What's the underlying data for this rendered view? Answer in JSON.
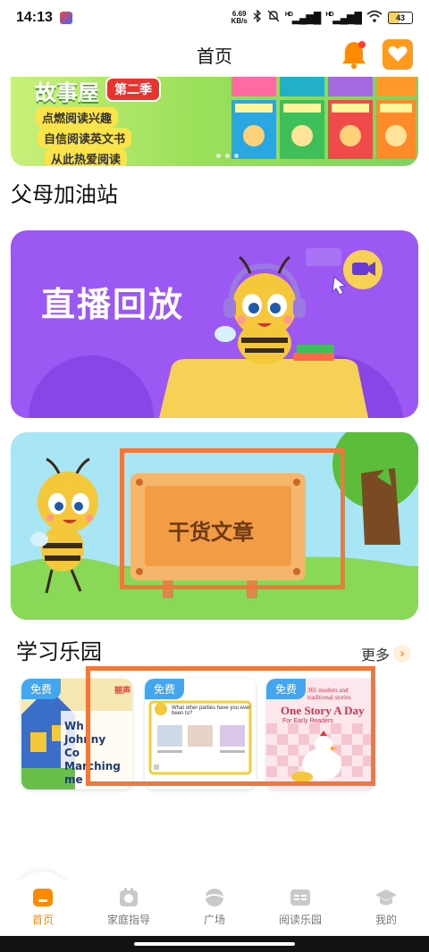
{
  "status_bar": {
    "time": "14:13",
    "net_speed_value": "6.69",
    "net_speed_unit": "KB/s",
    "signal_1": "HD",
    "signal_2": "HD",
    "battery": "43"
  },
  "header": {
    "title": "首页"
  },
  "top_banner": {
    "title": "故事屋",
    "season": "第二季",
    "lines": [
      "点燃阅读兴趣",
      "自信阅读英文书",
      "从此热爱阅读"
    ],
    "book_series": "哈乐潮读书·分级读物"
  },
  "parents_section": {
    "title": "父母加油站"
  },
  "live_banner": {
    "title": "直播回放"
  },
  "article_banner": {
    "title": "干货文章"
  },
  "learning_section": {
    "title": "学习乐园",
    "more_label": "更多",
    "cards": [
      {
        "badge": "免费",
        "brand": "丽声",
        "lines": [
          "Wh",
          "Johnny",
          "Co",
          "Marching",
          "me"
        ]
      },
      {
        "badge": "免费",
        "question": "What other parties have you ever been to?"
      },
      {
        "badge": "免费",
        "subtitle": "365 modern and traditional stories",
        "title": "One Story A Day",
        "tag": "For Early Readers"
      }
    ]
  },
  "bottom_nav": [
    {
      "label": "首页",
      "icon": "home-icon",
      "active": true
    },
    {
      "label": "家庭指导",
      "icon": "family-guide-icon"
    },
    {
      "label": "广场",
      "icon": "plaza-icon"
    },
    {
      "label": "阅读乐园",
      "icon": "reading-park-icon"
    },
    {
      "label": "我的",
      "icon": "profile-icon"
    }
  ],
  "colors": {
    "accent": "#ff8a00",
    "live_purple": "#9b58f2",
    "article_sky": "#a8e6f6",
    "highlight_frame": "#f2773a",
    "free_badge": "#43a6ef"
  }
}
